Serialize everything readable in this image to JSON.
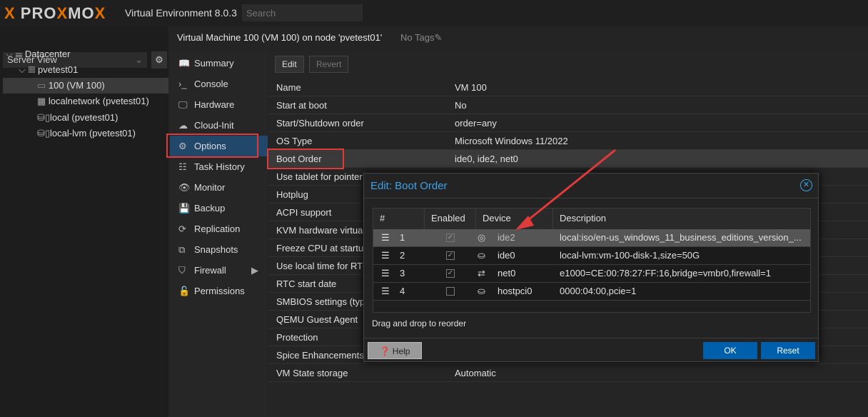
{
  "topbar": {
    "logo": "PROXMOX",
    "version": "Virtual Environment 8.0.3",
    "search_placeholder": "Search"
  },
  "left": {
    "view": "Server View",
    "tree": [
      "Datacenter",
      "pvetest01",
      "100 (VM 100)",
      "localnetwork (pvetest01)",
      "local (pvetest01)",
      "local-lvm (pvetest01)"
    ]
  },
  "header": {
    "title": "Virtual Machine 100 (VM 100) on node 'pvetest01'",
    "tags": "No Tags"
  },
  "nav": [
    "Summary",
    "Console",
    "Hardware",
    "Cloud-Init",
    "Options",
    "Task History",
    "Monitor",
    "Backup",
    "Replication",
    "Snapshots",
    "Firewall",
    "Permissions"
  ],
  "toolbar": {
    "edit": "Edit",
    "revert": "Revert"
  },
  "options": [
    {
      "k": "Name",
      "v": "VM 100"
    },
    {
      "k": "Start at boot",
      "v": "No"
    },
    {
      "k": "Start/Shutdown order",
      "v": "order=any"
    },
    {
      "k": "OS Type",
      "v": "Microsoft Windows 11/2022"
    },
    {
      "k": "Boot Order",
      "v": "ide0, ide2, net0"
    },
    {
      "k": "Use tablet for pointer",
      "v": ""
    },
    {
      "k": "Hotplug",
      "v": ""
    },
    {
      "k": "ACPI support",
      "v": ""
    },
    {
      "k": "KVM hardware virtualization",
      "v": ""
    },
    {
      "k": "Freeze CPU at startup",
      "v": ""
    },
    {
      "k": "Use local time for RTC",
      "v": ""
    },
    {
      "k": "RTC start date",
      "v": ""
    },
    {
      "k": "SMBIOS settings (type1)",
      "v": ""
    },
    {
      "k": "QEMU Guest Agent",
      "v": ""
    },
    {
      "k": "Protection",
      "v": ""
    },
    {
      "k": "Spice Enhancements",
      "v": ""
    },
    {
      "k": "VM State storage",
      "v": "Automatic"
    }
  ],
  "modal": {
    "title": "Edit: Boot Order",
    "columns": [
      "#",
      "Enabled",
      "Device",
      "Description"
    ],
    "rows": [
      {
        "n": "1",
        "enabled": true,
        "icon": "cdrom",
        "device": "ide2",
        "desc": "local:iso/en-us_windows_11_business_editions_version_..."
      },
      {
        "n": "2",
        "enabled": true,
        "icon": "hdd",
        "device": "ide0",
        "desc": "local-lvm:vm-100-disk-1,size=50G"
      },
      {
        "n": "3",
        "enabled": true,
        "icon": "exchange",
        "device": "net0",
        "desc": "e1000=CE:00:78:27:FF:16,bridge=vmbr0,firewall=1"
      },
      {
        "n": "4",
        "enabled": false,
        "icon": "hdd",
        "device": "hostpci0",
        "desc": "0000:04:00,pcie=1"
      }
    ],
    "hint": "Drag and drop to reorder",
    "help": "Help",
    "ok": "OK",
    "reset": "Reset"
  },
  "colors": {
    "accent": "#3da2e6",
    "button": "#005fad",
    "highlight": "#e03a3a"
  }
}
